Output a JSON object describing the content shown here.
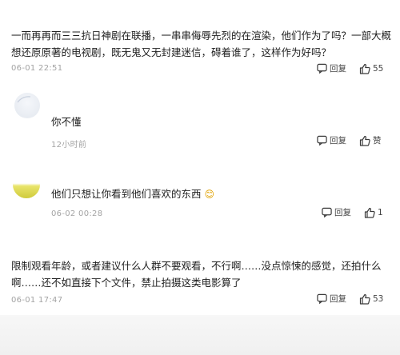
{
  "comments": [
    {
      "text_line1": "一而再再而三三抗日神剧在联播，一串串侮辱先烈的在渲染，他们作为了吗？一部大概",
      "text_line2": "想还原原著的电视剧，既无鬼又无封建迷信，碍着谁了，这样作为好吗？",
      "time": "06-01 22:51",
      "reply_label": "回复",
      "like_count": "55"
    },
    {
      "text": "你不懂",
      "time": "12小时前",
      "reply_label": "回复",
      "like_label": "赞"
    },
    {
      "text": "他们只想让你看到他们喜欢的东西",
      "emoji": "😊",
      "time": "06-02 00:28",
      "reply_label": "回复",
      "like_count": "1"
    },
    {
      "text_line1": "限制观看年龄，或者建议什么人群不要观看，不行啊……没点惊悚的感觉，还拍什么",
      "text_line2": "啊……还不如直接下个文件，禁止拍摄这类电影算了",
      "time": "06-01 17:47",
      "reply_label": "回复",
      "like_count": "53"
    }
  ],
  "colors": {
    "text": "#1e1e1e",
    "meta": "#a3a3a3",
    "icon": "#3a3a3a"
  },
  "icons": [
    "reply-icon",
    "thumbs-up-icon",
    "avatar"
  ]
}
